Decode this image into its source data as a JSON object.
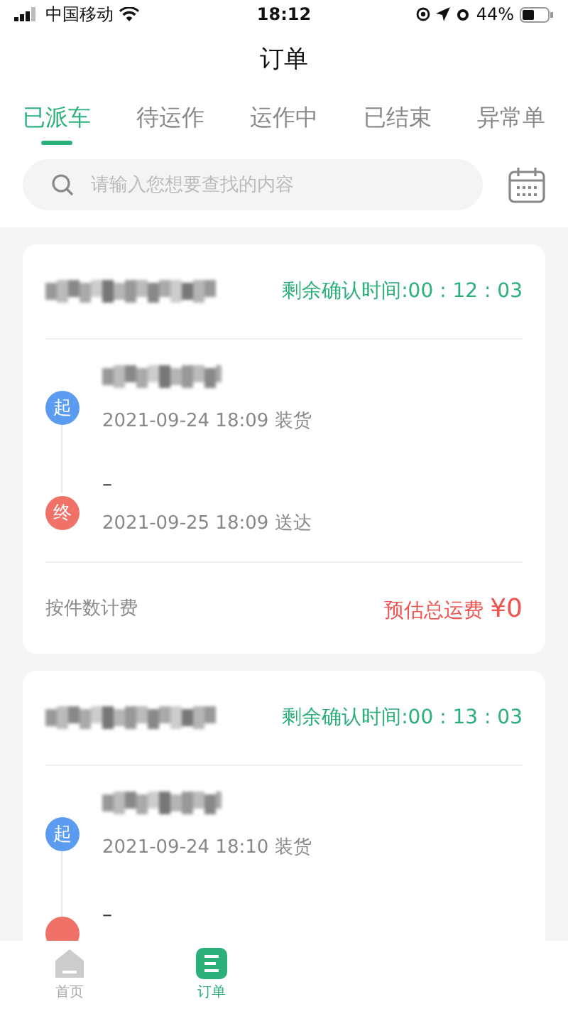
{
  "status_bar": {
    "carrier": "中国移动",
    "time": "18:12",
    "battery": "44%"
  },
  "header": {
    "title": "订单"
  },
  "tabs": [
    {
      "label": "已派车",
      "selected": true
    },
    {
      "label": "待运作",
      "selected": false
    },
    {
      "label": "运作中",
      "selected": false
    },
    {
      "label": "已结束",
      "selected": false
    },
    {
      "label": "异常单",
      "selected": false
    }
  ],
  "search": {
    "placeholder": "请输入您想要查找的内容"
  },
  "orders": [
    {
      "name_redacted": true,
      "countdown": "剩余确认时间:00 : 12 : 03",
      "stops": [
        {
          "kind": "start",
          "badge": "起",
          "address_redacted": true,
          "time": "2021-09-24 18:09 装货"
        },
        {
          "kind": "end",
          "badge": "终",
          "address": "–",
          "time": "2021-09-25 18:09 送达"
        }
      ],
      "billing": "按件数计费",
      "fee_label": "预估总运费",
      "fee": "¥0"
    },
    {
      "name_redacted": true,
      "countdown": "剩余确认时间:00 : 13 : 03",
      "stops": [
        {
          "kind": "start",
          "badge": "起",
          "address_redacted": true,
          "time": "2021-09-24 18:10 装货"
        },
        {
          "kind": "end",
          "address": "–"
        }
      ]
    }
  ],
  "bottom_nav": [
    {
      "label": "首页",
      "kind": "home",
      "selected": false
    },
    {
      "label": "订单",
      "kind": "orders",
      "selected": true
    }
  ]
}
